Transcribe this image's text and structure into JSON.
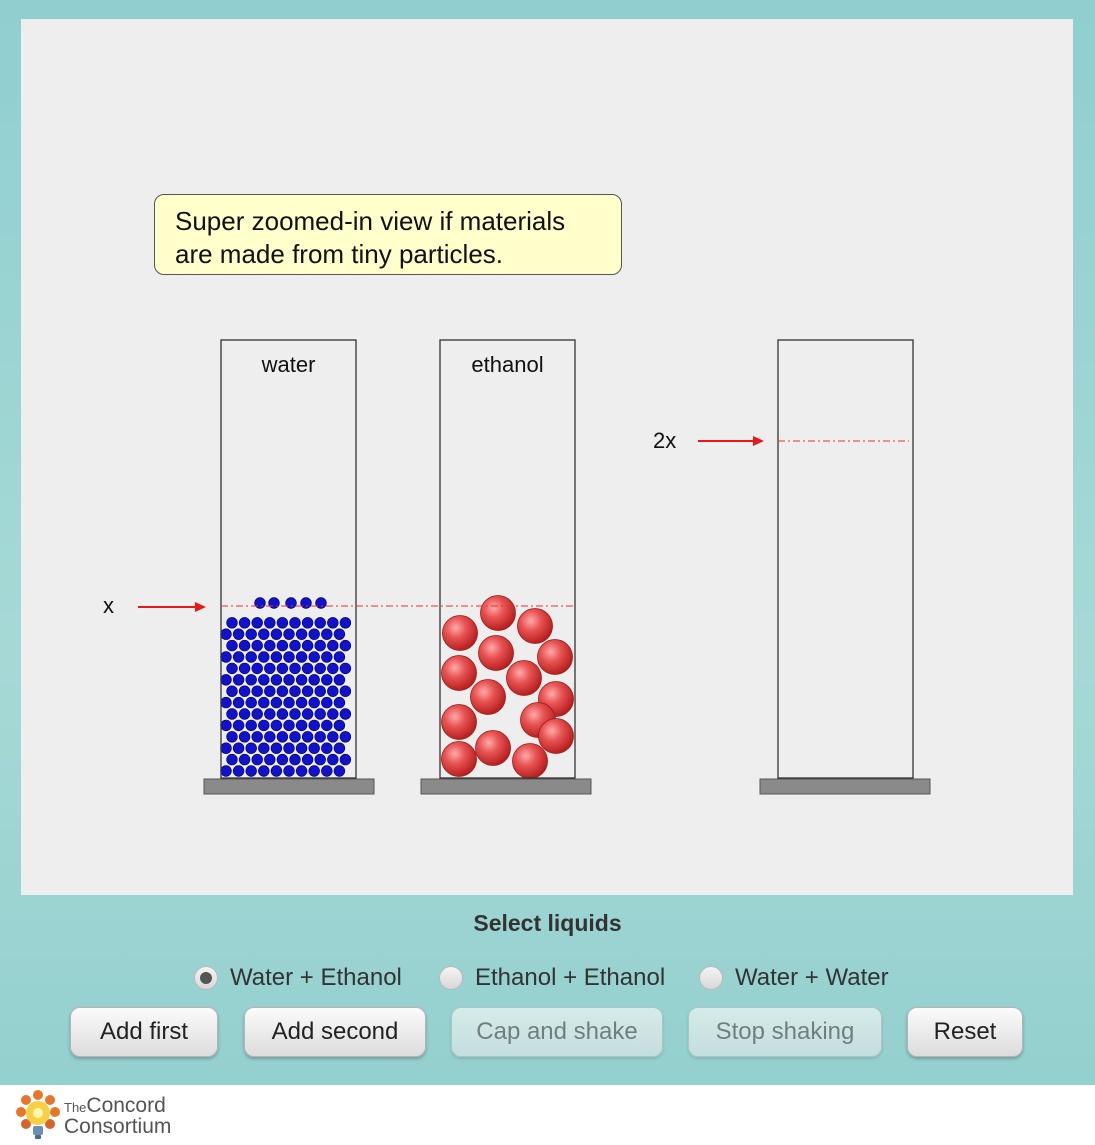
{
  "note": {
    "line1": "Super zoomed-in view if materials",
    "line2": "are made from tiny particles."
  },
  "cylinders": {
    "first_label": "water",
    "second_label": "ethanol",
    "third_label": ""
  },
  "markers": {
    "x_label": "x",
    "twox_label": "2x"
  },
  "controls": {
    "title": "Select liquids",
    "options": [
      {
        "label": "Water + Ethanol",
        "selected": true
      },
      {
        "label": "Ethanol + Ethanol",
        "selected": false
      },
      {
        "label": "Water + Water",
        "selected": false
      }
    ],
    "buttons": {
      "add_first": "Add first",
      "add_second": "Add second",
      "cap_and_shake": "Cap and shake",
      "stop_shaking": "Stop shaking",
      "reset": "Reset"
    }
  },
  "footer": {
    "logo_the": "The",
    "logo_concord": "Concord",
    "logo_consortium": "Consortium"
  },
  "colors": {
    "water_particle": "#1212cc",
    "ethanol_particle": "#e04848",
    "marker_arrow": "#e81818",
    "note_background": "#ffffcc"
  }
}
